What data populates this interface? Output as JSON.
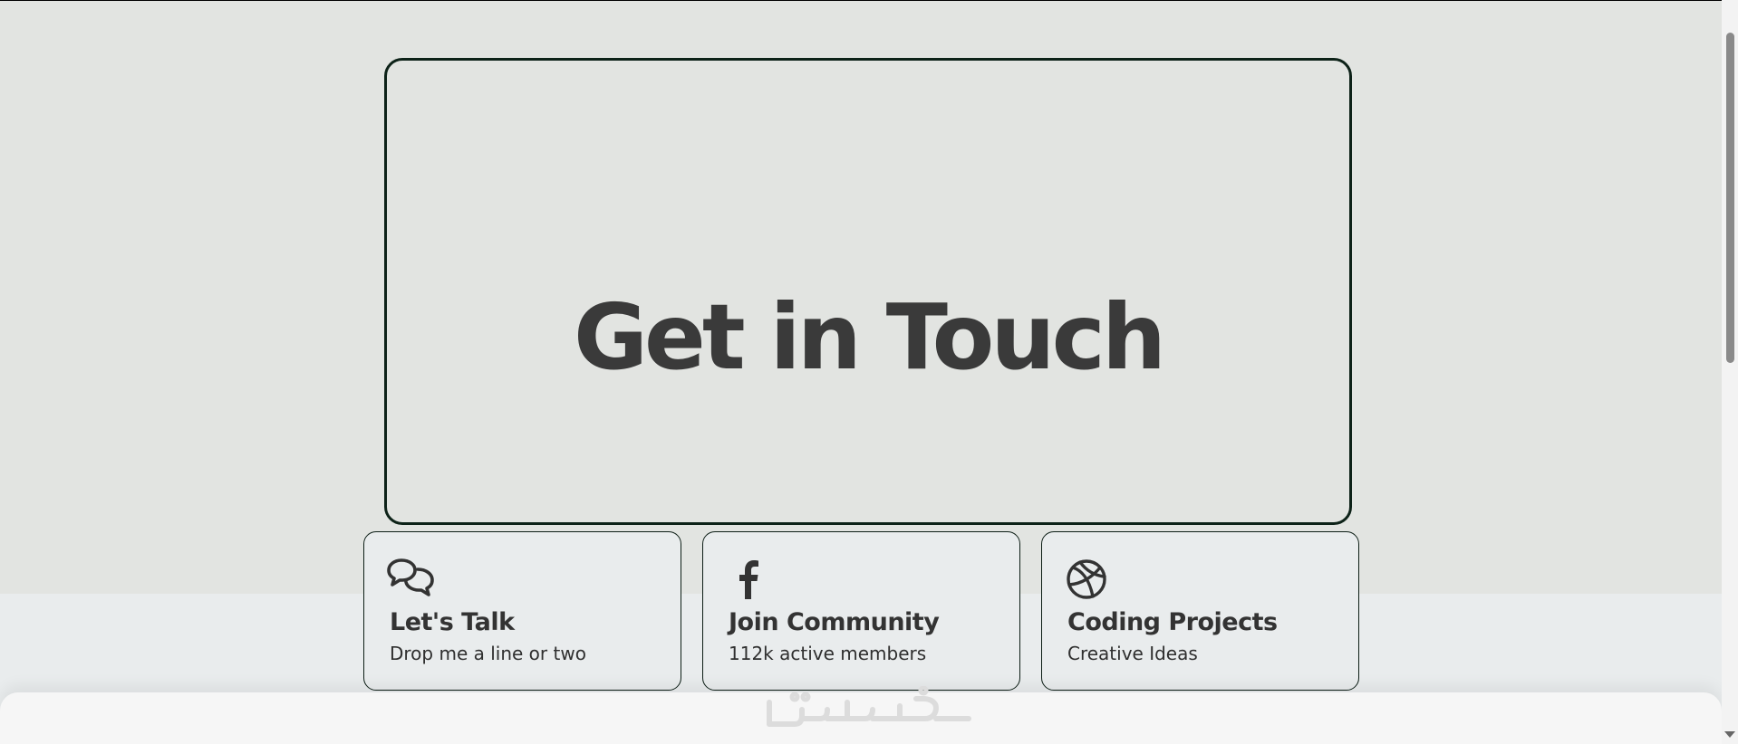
{
  "hero": {
    "title": "Get in Touch"
  },
  "cards": [
    {
      "icon": "chat-bubbles-icon",
      "title": "Let's Talk",
      "subtitle": "Drop me a line or two"
    },
    {
      "icon": "facebook-icon",
      "title": "Join Community",
      "subtitle": "112k active members"
    },
    {
      "icon": "dribbble-icon",
      "title": "Coding Projects",
      "subtitle": "Creative Ideas"
    }
  ],
  "footer": {
    "watermark_text": "خمسات"
  },
  "colors": {
    "hero_background": "#e2e4e1",
    "page_background": "#e9eced",
    "border": "#0d2218",
    "text": "#3a3a3a",
    "footer_background": "#f6f6f6"
  }
}
